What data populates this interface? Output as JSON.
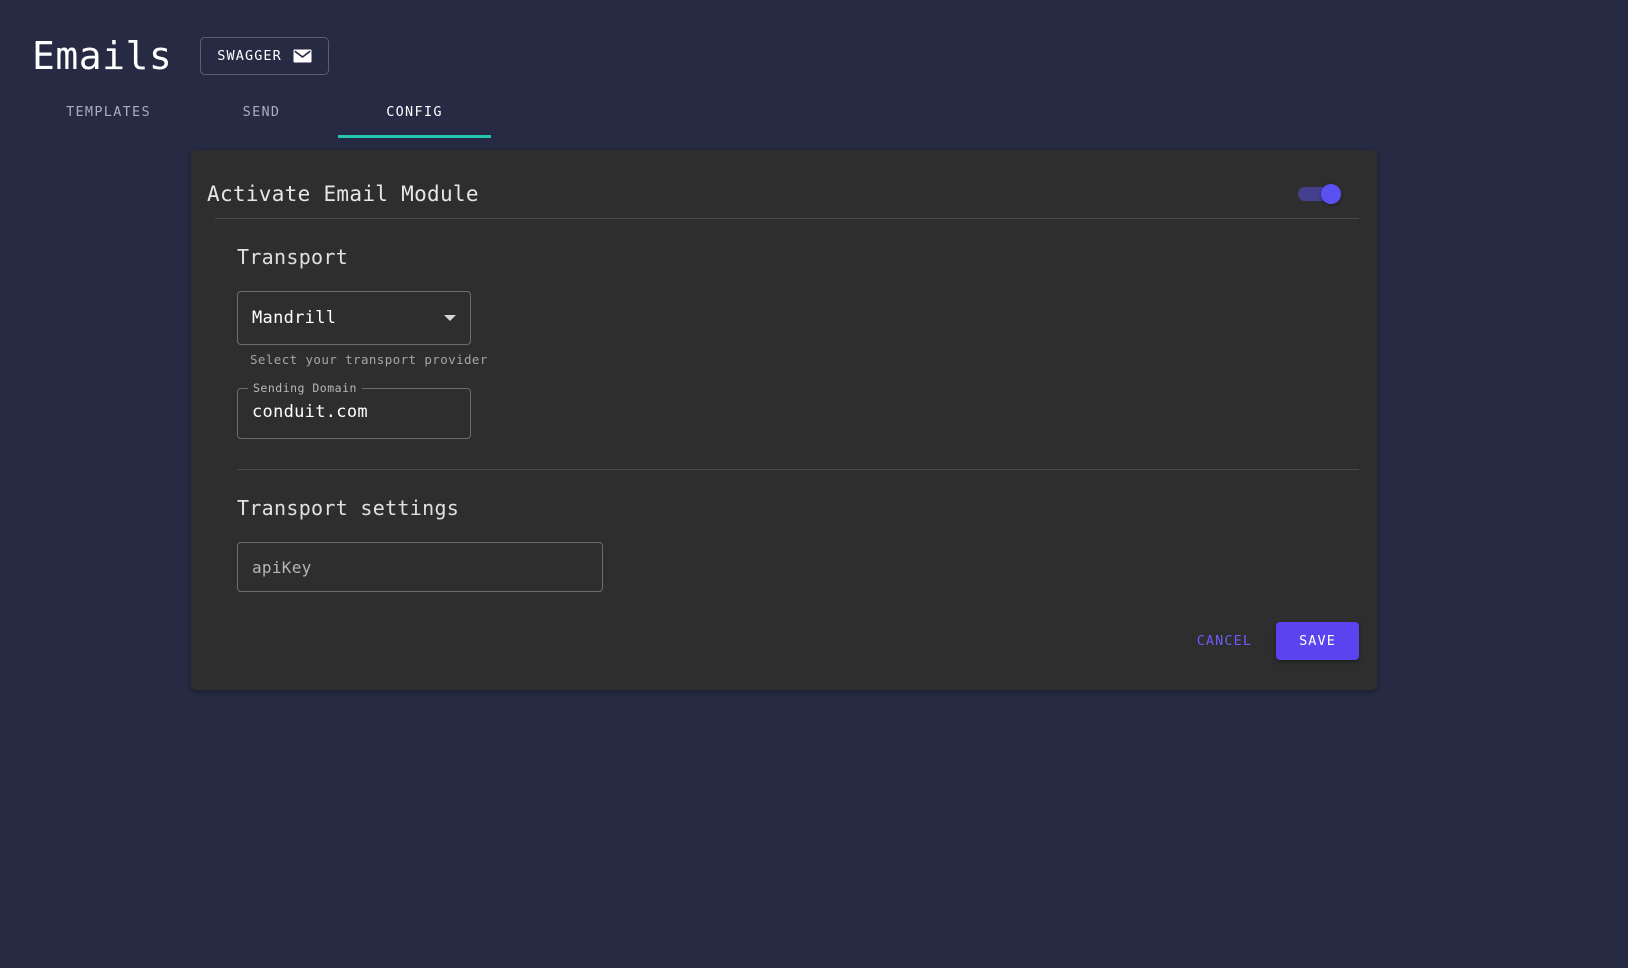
{
  "header": {
    "title": "Emails",
    "swagger_button": {
      "label": "SWAGGER",
      "icon": "envelope-icon"
    }
  },
  "tabs": [
    {
      "label": "TEMPLATES",
      "active": false
    },
    {
      "label": "SEND",
      "active": false
    },
    {
      "label": "CONFIG",
      "active": true
    }
  ],
  "card": {
    "header_title": "Activate Email Module",
    "module_toggle": {
      "state": "on",
      "track_color": "#453f8f",
      "thumb_color": "#5b51f0"
    },
    "transport_section": {
      "title": "Transport",
      "select": {
        "value": "Mandrill",
        "caret_icon": "chevron-down-icon"
      },
      "helper_text": "Select your transport provider",
      "sending_domain": {
        "label": "Sending Domain",
        "value": "conduit.com"
      }
    },
    "transport_settings_section": {
      "title": "Transport settings",
      "api_key": {
        "placeholder": "apiKey",
        "value": ""
      }
    },
    "actions": {
      "cancel_label": "CANCEL",
      "save_label": "SAVE"
    }
  },
  "colors": {
    "page_background": "#262a42",
    "card_background": "#2e2e2e",
    "tab_accent": "#26c6b0",
    "primary_purple": "#5b43f0",
    "cancel_text": "#6c5cf5"
  }
}
